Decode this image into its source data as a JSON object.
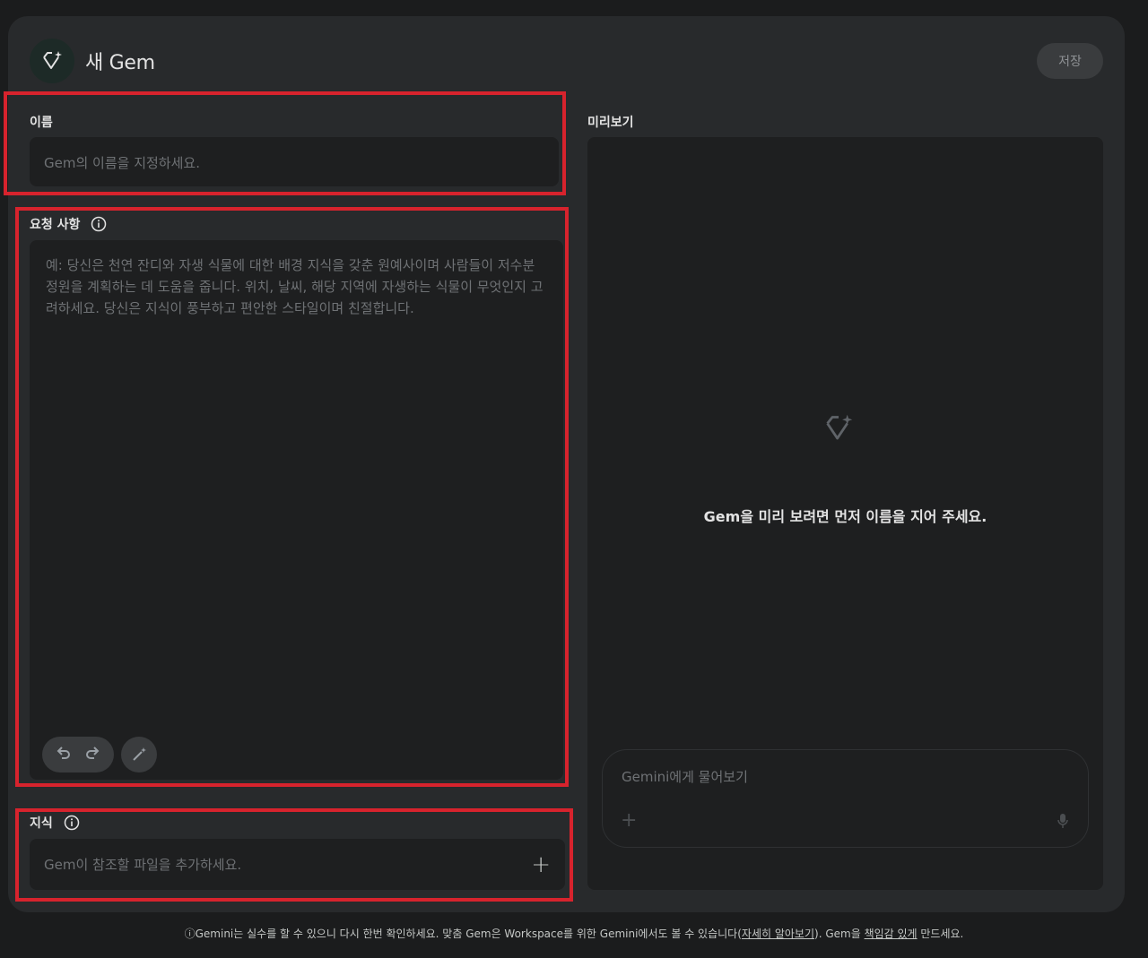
{
  "header": {
    "title": "새 Gem",
    "save_label": "저장"
  },
  "name_section": {
    "label": "이름",
    "placeholder": "Gem의 이름을 지정하세요."
  },
  "instructions_section": {
    "label": "요청 사항",
    "placeholder": "예: 당신은 천연 잔디와 자생 식물에 대한 배경 지식을 갖춘 원예사이며 사람들이 저수분 정원을 계획하는 데 도움을 줍니다. 위치, 날씨, 해당 지역에 자생하는 식물이 무엇인지 고려하세요. 당신은 지식이 풍부하고 편안한 스타일이며 친절합니다."
  },
  "knowledge_section": {
    "label": "지식",
    "placeholder": "Gem이 참조할 파일을 추가하세요."
  },
  "preview": {
    "label": "미리보기",
    "message": "Gem을 미리 보려면 먼저 이름을 지어 주세요.",
    "input_placeholder": "Gemini에게 물어보기"
  },
  "footer": {
    "text_before": "ⓘGemini는 실수를 할 수 있으니 다시 한번 확인하세요. 맞춤 Gem은 Workspace를 위한 Gemini에서도 볼 수 있습니다(",
    "link1": "자세히 알아보기",
    "text_middle": "). Gem을 ",
    "link2": "책임감 있게",
    "text_after": " 만드세요."
  },
  "colors": {
    "background": "#1b1c1d",
    "panel": "#282a2c",
    "field": "#1e1f20",
    "highlight": "#d7232d"
  },
  "icons": [
    "gem-icon",
    "info-icon",
    "undo-icon",
    "redo-icon",
    "magic-pen-icon",
    "plus-icon",
    "mic-icon"
  ]
}
